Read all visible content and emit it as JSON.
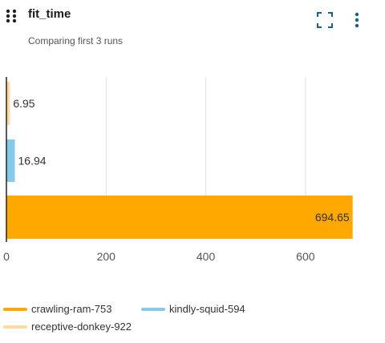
{
  "panel": {
    "title": "fit_time",
    "subtitle": "Comparing first 3 runs"
  },
  "icons": {
    "drag": "drag-handle-icon",
    "expand": "expand-icon",
    "more": "more-vertical-icon"
  },
  "colors": {
    "crawling-ram-753": "#ffa800",
    "kindly-squid-594": "#87c9e8",
    "receptive-donkey-922": "#ffd9a0",
    "icon": "#1b5e8f",
    "grid": "#e3e3e3",
    "axis": "#222222"
  },
  "chart_data": {
    "type": "bar",
    "orientation": "horizontal",
    "title": "fit_time",
    "categories": [
      "receptive-donkey-922",
      "kindly-squid-594",
      "crawling-ram-753"
    ],
    "values": [
      6.95,
      16.94,
      694.65
    ],
    "data_labels": [
      "6.95",
      "16.94",
      "694.65"
    ],
    "xlim": [
      0,
      700
    ],
    "xticks": [
      0,
      200,
      400,
      600
    ],
    "xlabel": "",
    "ylabel": "",
    "grid": true,
    "legend_position": "bottom"
  },
  "legend": [
    {
      "label": "crawling-ram-753",
      "color": "#ffa800"
    },
    {
      "label": "kindly-squid-594",
      "color": "#87c9e8"
    },
    {
      "label": "receptive-donkey-922",
      "color": "#ffd9a0"
    }
  ]
}
